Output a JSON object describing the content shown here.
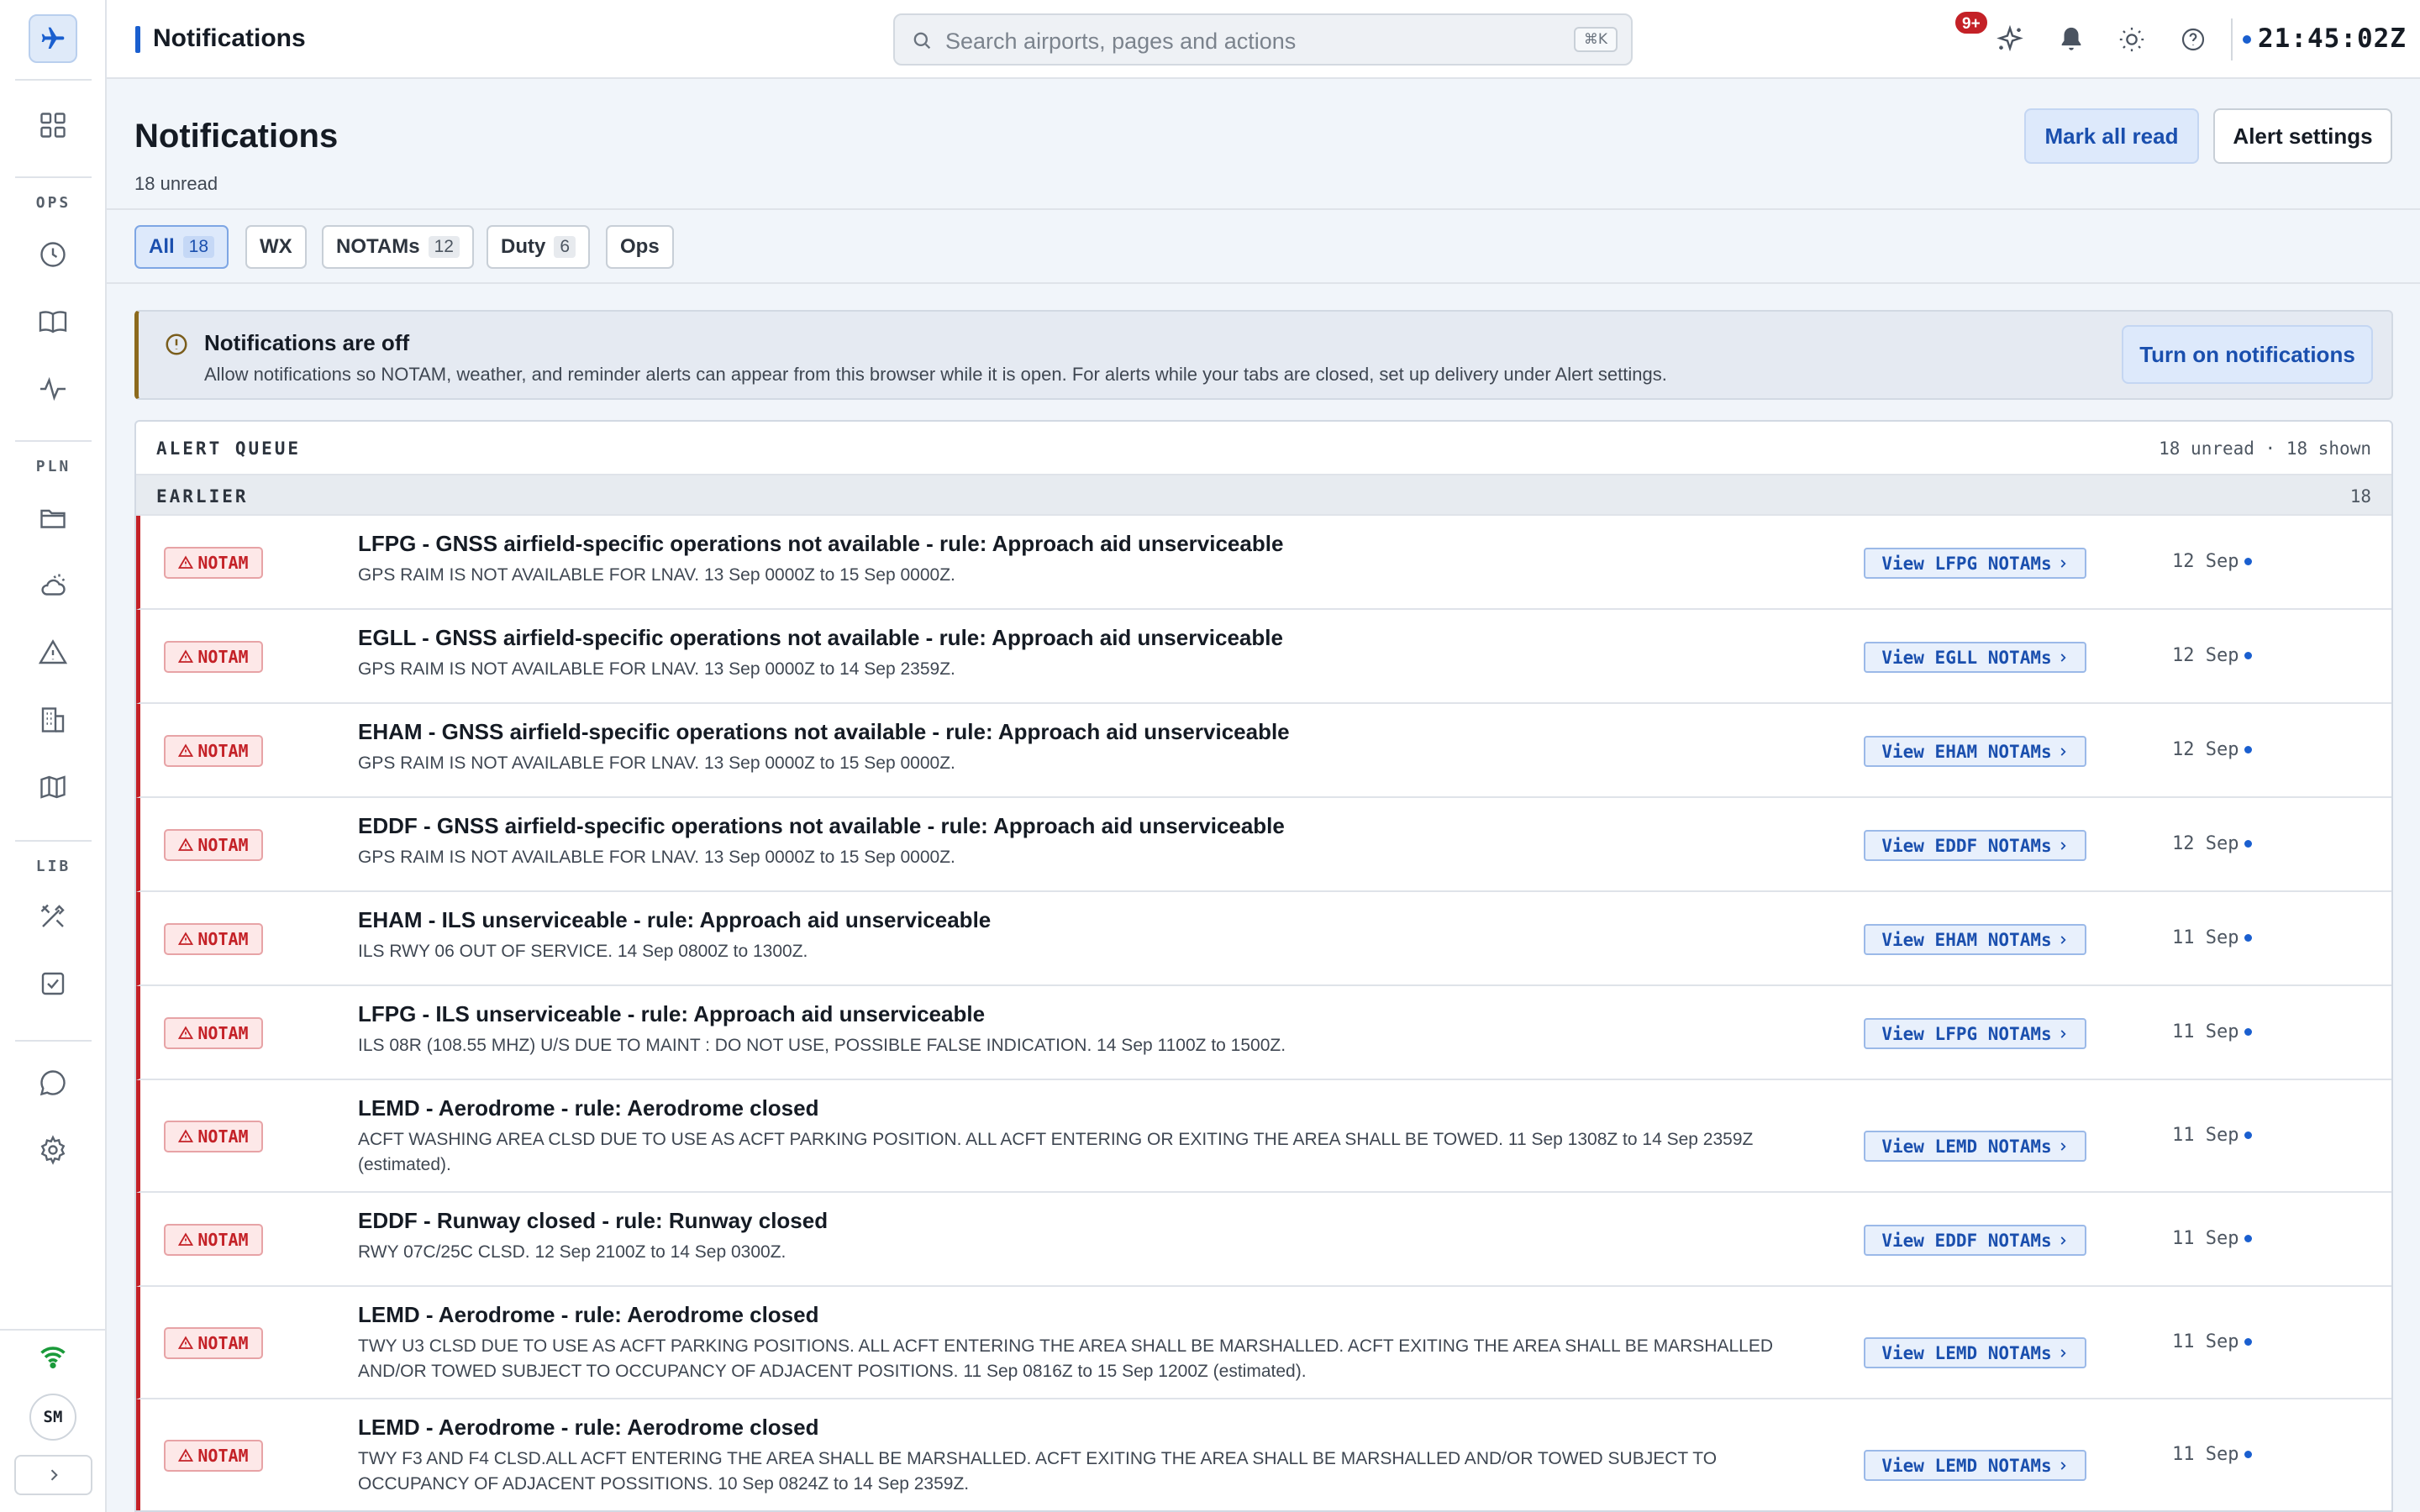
{
  "topbar": {
    "title": "Notifications",
    "search_placeholder": "Search airports, pages and actions",
    "search_shortcut": "⌘K",
    "notif_badge": "9+",
    "clock": "21:45:02Z"
  },
  "sidebar": {
    "groups": {
      "ops": "OPS",
      "pln": "PLN",
      "lib": "LIB"
    },
    "avatar_initials": "SM"
  },
  "page": {
    "title": "Notifications",
    "subtitle": "18 unread",
    "mark_all_read": "Mark all read",
    "alert_settings": "Alert settings"
  },
  "tabs": [
    {
      "label": "All",
      "count": "18",
      "active": true
    },
    {
      "label": "WX",
      "count": "",
      "active": false
    },
    {
      "label": "NOTAMs",
      "count": "12",
      "active": false
    },
    {
      "label": "Duty",
      "count": "6",
      "active": false
    },
    {
      "label": "Ops",
      "count": "",
      "active": false
    }
  ],
  "banner": {
    "title": "Notifications are off",
    "text": "Allow notifications so NOTAM, weather, and reminder alerts can appear from this browser while it is open. For alerts while your tabs are closed, set up delivery under Alert settings.",
    "button": "Turn on notifications"
  },
  "queue": {
    "title": "ALERT QUEUE",
    "meta": "18 unread · 18 shown",
    "section_label": "EARLIER",
    "section_count": "18",
    "tag_label": "NOTAM",
    "items": [
      {
        "title": "LFPG - GNSS airfield-specific operations not available - rule: Approach aid unserviceable",
        "desc": "GPS RAIM IS NOT AVAILABLE FOR LNAV. 13 Sep 0000Z to 15 Sep 0000Z.",
        "link": "View LFPG NOTAMs",
        "date": "12 Sep"
      },
      {
        "title": "EGLL - GNSS airfield-specific operations not available - rule: Approach aid unserviceable",
        "desc": "GPS RAIM IS NOT AVAILABLE FOR LNAV. 13 Sep 0000Z to 14 Sep 2359Z.",
        "link": "View EGLL NOTAMs",
        "date": "12 Sep"
      },
      {
        "title": "EHAM - GNSS airfield-specific operations not available - rule: Approach aid unserviceable",
        "desc": "GPS RAIM IS NOT AVAILABLE FOR LNAV. 13 Sep 0000Z to 15 Sep 0000Z.",
        "link": "View EHAM NOTAMs",
        "date": "12 Sep"
      },
      {
        "title": "EDDF - GNSS airfield-specific operations not available - rule: Approach aid unserviceable",
        "desc": "GPS RAIM IS NOT AVAILABLE FOR LNAV. 13 Sep 0000Z to 15 Sep 0000Z.",
        "link": "View EDDF NOTAMs",
        "date": "12 Sep"
      },
      {
        "title": "EHAM - ILS unserviceable - rule: Approach aid unserviceable",
        "desc": "ILS RWY 06 OUT OF SERVICE. 14 Sep 0800Z to 1300Z.",
        "link": "View EHAM NOTAMs",
        "date": "11 Sep"
      },
      {
        "title": "LFPG - ILS unserviceable - rule: Approach aid unserviceable",
        "desc": "ILS 08R (108.55 MHZ) U/S DUE TO MAINT : DO NOT USE, POSSIBLE FALSE INDICATION. 14 Sep 1100Z to 1500Z.",
        "link": "View LFPG NOTAMs",
        "date": "11 Sep"
      },
      {
        "title": "LEMD - Aerodrome - rule: Aerodrome closed",
        "desc": "ACFT WASHING AREA CLSD DUE TO USE AS ACFT PARKING POSITION. ALL ACFT ENTERING OR EXITING THE AREA SHALL BE TOWED. 11 Sep 1308Z to 14 Sep 2359Z (estimated).",
        "link": "View LEMD NOTAMs",
        "date": "11 Sep"
      },
      {
        "title": "EDDF - Runway closed - rule: Runway closed",
        "desc": "RWY 07C/25C CLSD. 12 Sep 2100Z to 14 Sep 0300Z.",
        "link": "View EDDF NOTAMs",
        "date": "11 Sep"
      },
      {
        "title": "LEMD - Aerodrome - rule: Aerodrome closed",
        "desc": "TWY U3 CLSD DUE TO USE AS ACFT PARKING POSITIONS. ALL ACFT ENTERING THE AREA SHALL BE MARSHALLED. ACFT EXITING THE AREA SHALL BE MARSHALLED AND/OR TOWED SUBJECT TO OCCUPANCY OF ADJACENT POSITIONS. 11 Sep 0816Z to 15 Sep 1200Z (estimated).",
        "link": "View LEMD NOTAMs",
        "date": "11 Sep"
      },
      {
        "title": "LEMD - Aerodrome - rule: Aerodrome closed",
        "desc": "TWY F3 AND F4 CLSD.ALL ACFT ENTERING THE AREA SHALL BE MARSHALLED. ACFT EXITING THE AREA SHALL BE MARSHALLED AND/OR TOWED SUBJECT TO OCCUPANCY OF ADJACENT POSSITIONS. 10 Sep 0824Z to 14 Sep 2359Z.",
        "link": "View LEMD NOTAMs",
        "date": "11 Sep"
      }
    ]
  }
}
